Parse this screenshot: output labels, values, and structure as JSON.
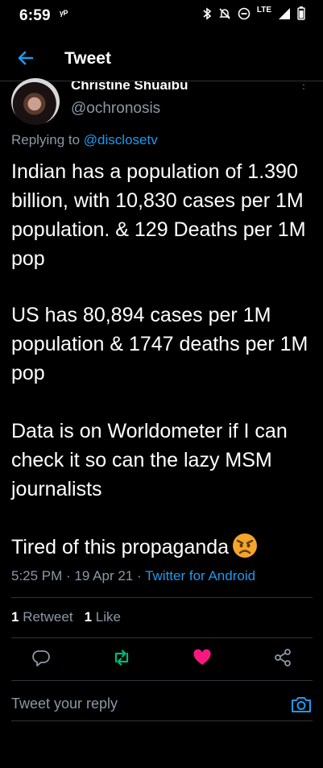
{
  "status_bar": {
    "time": "6:59",
    "left_icon": "ᵞᴾ",
    "network": "LTE"
  },
  "header": {
    "title": "Tweet"
  },
  "author": {
    "name": "Christine Shuaibu",
    "handle": "@ochronosis"
  },
  "replying": {
    "prefix": "Replying to",
    "mention": "@disclosetv"
  },
  "tweet": {
    "paragraphs": [
      "Indian has a population of 1.390 billion, with 10,830 cases per 1M population. & 129 Deaths per 1M  pop",
      "US  has 80,894 cases per 1M population & 1747 deaths per 1M pop",
      "Data is on Worldometer if I can check it so can the lazy MSM journalists",
      "Tired of this propaganda"
    ],
    "emoji": "angry-face"
  },
  "meta": {
    "time": "5:25 PM",
    "sep": "·",
    "date": "19 Apr 21",
    "source": "Twitter for Android"
  },
  "stats": {
    "retweets_count": "1",
    "retweets_label": "Retweet",
    "likes_count": "1",
    "likes_label": "Like"
  },
  "actions": {
    "reply_icon": "comment-icon",
    "retweet_icon": "retweet-icon",
    "like_icon": "heart-icon",
    "share_icon": "share-icon"
  },
  "reply_box": {
    "placeholder": "Tweet your reply"
  },
  "colors": {
    "background": "#000000",
    "accent": "#1d9bf0",
    "muted": "#8b98a5",
    "retweet_active": "#00ba7c",
    "like_active": "#f91880",
    "divider": "#2f3336"
  }
}
